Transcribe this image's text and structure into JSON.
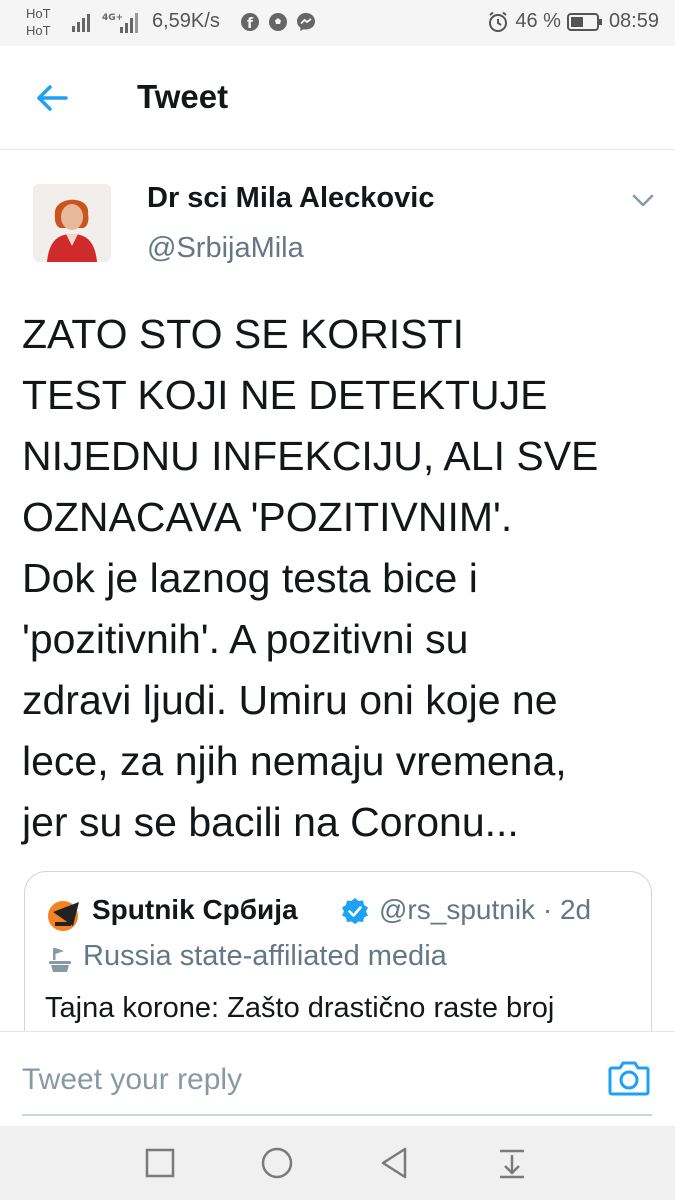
{
  "status_bar": {
    "carrier_line1": "HoT",
    "carrier_line2": "HoT",
    "network_type": "4G+",
    "net_speed": "6,59K/s",
    "battery_percent": "46 %",
    "time": "08:59",
    "app_icons": [
      "facebook-icon",
      "soccer-icon",
      "messenger-icon"
    ]
  },
  "header": {
    "title": "Tweet",
    "back_icon": "back-arrow-icon"
  },
  "tweet": {
    "author_name": "Dr sci Mila Aleckovic",
    "author_handle": "@SrbijaMila",
    "text": "ZATO STO SE KORISTI\nTEST KOJI NE DETEKTUJE\nNIJEDNU INFEKCIJU, ALI SVE\nOZNACAVA 'POZITIVNIM'.\nDok je laznog testa bice i\n'pozitivnih'. A pozitivni su\nzdravi ljudi. Umiru oni koje ne\nlece, za njih nemaju vremena,\njer su se bacili na Coronu..."
  },
  "quoted_tweet": {
    "name": "Sputnik Србија",
    "handle": "@rs_sputnik",
    "separator": "·",
    "age": "2d",
    "label": "Russia state-affiliated media",
    "text": "Tajna korone: Zašto drastično raste broj"
  },
  "reply": {
    "placeholder": "Tweet your reply"
  },
  "colors": {
    "accent": "#1da1f2",
    "text": "#14171a",
    "secondary": "#657786",
    "border": "#e1e8ed"
  }
}
